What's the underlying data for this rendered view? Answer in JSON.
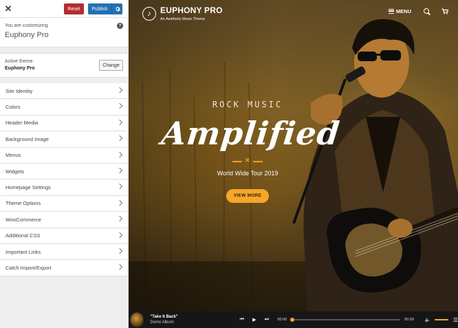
{
  "sidebar": {
    "close_symbol": "✕",
    "reset_label": "Reset",
    "publish_label": "Publish",
    "customizing_label": "You are customizing",
    "site_name": "Euphony Pro",
    "active_theme_label": "Active theme",
    "active_theme_name": "Euphony Pro",
    "change_label": "Change",
    "sections": [
      "Site Identity",
      "Colors",
      "Header Media",
      "Background Image",
      "Menus",
      "Widgets",
      "Homepage Settings",
      "Theme Options",
      "WooCommerce",
      "Additional CSS",
      "Important Links",
      "Catch Import/Export"
    ]
  },
  "preview": {
    "site_title": "EUPHONY PRO",
    "tagline": "An Aesthetic Music Theme",
    "menu_label": "MENU",
    "hero_kicker": "ROCK MUSIC",
    "hero_title": "Amplified",
    "hero_subtitle": "World Wide Tour 2019",
    "cta_label": "VIEW MORE"
  },
  "player": {
    "track_title": "\"Take It Back\"",
    "album": "Demo Album",
    "current_time": "00:00",
    "duration": "00:00",
    "progress": 0,
    "volume": 1.0
  },
  "colors": {
    "reset": "#b32d2e",
    "publish": "#2271b1",
    "accent": "#f7a62a"
  }
}
